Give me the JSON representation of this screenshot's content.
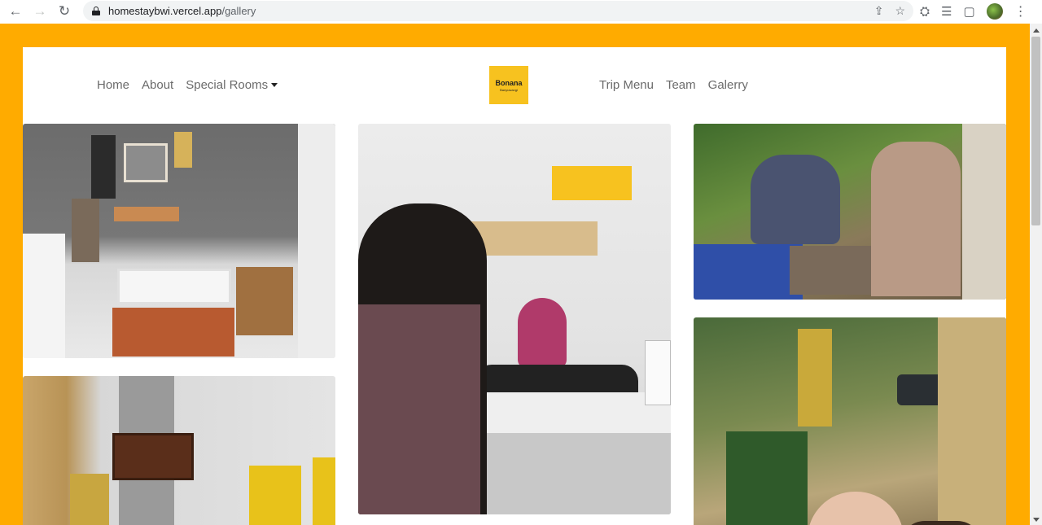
{
  "browser": {
    "url_host": "homestaybwi.vercel.app",
    "url_path": "/gallery",
    "icons": [
      "back-icon",
      "forward-icon",
      "reload-icon",
      "lock-icon",
      "share-icon",
      "star-icon",
      "extensions-icon",
      "media-icon",
      "sidepanel-icon",
      "profile-avatar",
      "menu-icon"
    ]
  },
  "nav": {
    "left": [
      {
        "label": "Home"
      },
      {
        "label": "About"
      },
      {
        "label": "Special Rooms"
      }
    ],
    "right": [
      {
        "label": "Trip Menu"
      },
      {
        "label": "Team"
      },
      {
        "label": "Galerry"
      }
    ],
    "logo": {
      "name": "Bonana",
      "sub": "Banyuwangi"
    }
  },
  "colors": {
    "page_bg": "#ffab00",
    "logo_bg": "#f7c21f"
  },
  "gallery": {
    "photo_count": 5
  }
}
